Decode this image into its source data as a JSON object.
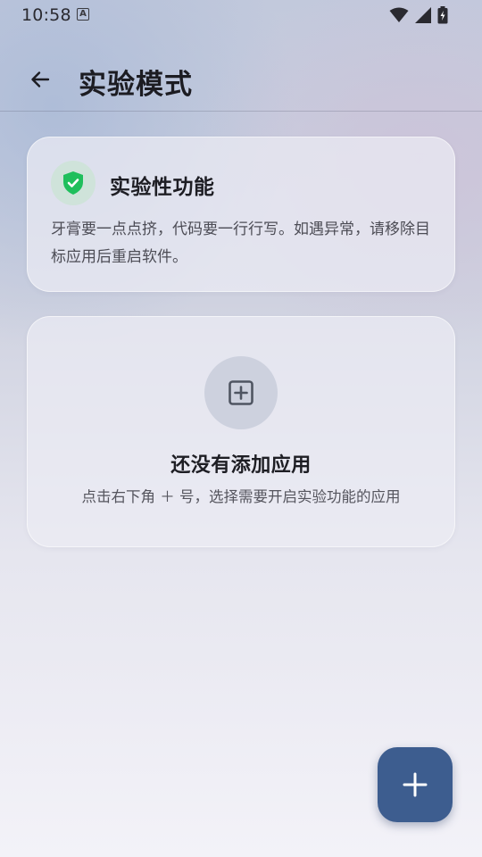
{
  "status_bar": {
    "time": "10:58",
    "notification_icon": "font-a-icon",
    "icons": [
      "wifi-icon",
      "cellular-signal-icon",
      "battery-charging-icon"
    ]
  },
  "app_bar": {
    "back_icon": "arrow-back-icon",
    "title": "实验模式"
  },
  "info_card": {
    "icon": "shield-check-icon",
    "title": "实验性功能",
    "text": "牙膏要一点点挤，代码要一行行写。如遇异常，请移除目标应用后重启软件。"
  },
  "empty_state": {
    "icon": "add-box-icon",
    "title": "还没有添加应用",
    "hint": "点击右下角 ＋ 号，选择需要开启实验功能的应用"
  },
  "fab": {
    "icon": "plus-icon"
  },
  "colors": {
    "accent": "#3d5d8f",
    "shield_green": "#1fbf5c",
    "shield_bg": "#cfe3da"
  }
}
